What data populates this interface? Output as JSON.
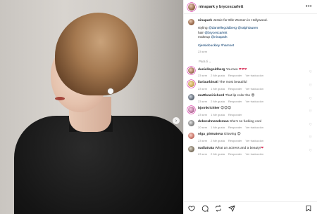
{
  "post": {
    "header": {
      "names": "ninapark y brycescarlett",
      "more_label": "•••"
    },
    "caption": {
      "author": "ninapark",
      "line1": " Jessie for Elle Women in Hollywood.",
      "styling_label": "styling ",
      "styling_accounts": "@daniellegoldberg @ralphlauren",
      "hair_label": "hair ",
      "hair_account": "@brycescarlett",
      "makeup_label": "makeup ",
      "makeup_account": "@ninapark",
      "hashtags": "#jessiebuckley #hamnet",
      "time": "23 sem"
    },
    "for_you_label": "Para ti",
    "comments": [
      {
        "user": "daniellegoldberg",
        "text": " You two ",
        "emoji": "❤❤❤",
        "emoji_type": "heart",
        "time": "23 sem",
        "likes": "2 Me gusta",
        "reply": "Responder",
        "translation": "Ver traducción"
      },
      {
        "user": "ilariaurbinati",
        "text": " The most beautiful",
        "emoji": "",
        "emoji_type": "none",
        "time": "23 sem",
        "likes": "1 Me gusta",
        "reply": "Responder",
        "translation": "Ver traducción"
      },
      {
        "user": "matthewirichord",
        "text": " That lip color tho ",
        "emoji": "😍",
        "emoji_type": "face",
        "time": "23 sem",
        "likes": "2 Me gusta",
        "reply": "Responder",
        "translation": "Ver traducción"
      },
      {
        "user": "bjornkrichker",
        "text": " ",
        "emoji": "😍😍😍",
        "emoji_type": "face",
        "time": "23 sem",
        "likes": "1 Me gusta",
        "reply": "Responder",
        "translation": ""
      },
      {
        "user": "deborahnewdeman",
        "text": " She's so fucking cool",
        "emoji": "",
        "emoji_type": "none",
        "time": "20 sem",
        "likes": "1 Me gusta",
        "reply": "Responder",
        "translation": "Ver traducción"
      },
      {
        "user": "olga_pirmatova",
        "text": " Glowing ",
        "emoji": "😍",
        "emoji_type": "face",
        "time": "23 sem",
        "likes": "2 Me gusta",
        "reply": "Responder",
        "translation": "Ver traducción"
      },
      {
        "user": "nadiatrata",
        "text": " What an actress and a beauty!",
        "emoji": "❤",
        "emoji_type": "heart",
        "time": "23 sem",
        "likes": "2 Me gusta",
        "reply": "Responder",
        "translation": "Ver traducción"
      }
    ],
    "next_arrow": "›"
  }
}
